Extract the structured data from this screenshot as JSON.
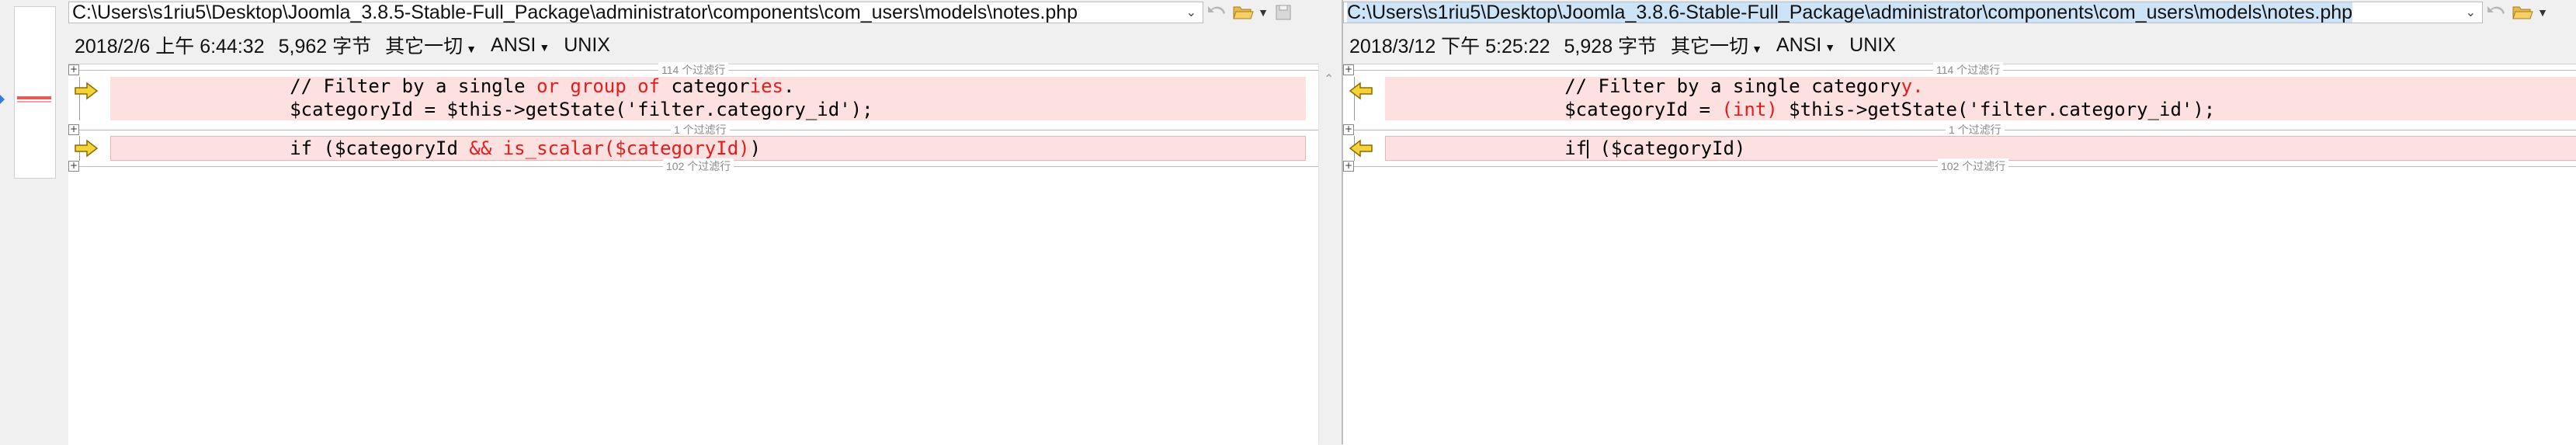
{
  "left": {
    "path": "C:\\Users\\s1riu5\\Desktop\\Joomla_3.8.5-Stable-Full_Package\\administrator\\components\\com_users\\models\\notes.php",
    "info": {
      "datetime": "2018/2/6 上午 6:44:32",
      "size": "5,962 字节",
      "filter": "其它一切",
      "encoding": "ANSI",
      "lineending": "UNIX"
    },
    "sep1": "114 个过滤行",
    "sep2": "1 个过滤行",
    "sep3": "102 个过滤行",
    "line1": {
      "indent": "                ",
      "a": "// Filter by a single ",
      "b": "or group of",
      "c": " categor",
      "d": "ies",
      "e": "."
    },
    "line2": {
      "indent": "                ",
      "text": "$categoryId = $this->getState('filter.category_id');"
    },
    "line3": {
      "indent": "                ",
      "a": "if ($categoryId ",
      "b": "&& is_scalar($categoryId)",
      "c": ")"
    }
  },
  "right": {
    "path": "C:\\Users\\s1riu5\\Desktop\\Joomla_3.8.6-Stable-Full_Package\\administrator\\components\\com_users\\models\\notes.php",
    "info": {
      "datetime": "2018/3/12 下午 5:25:22",
      "size": "5,928 字节",
      "filter": "其它一切",
      "encoding": "ANSI",
      "lineending": "UNIX"
    },
    "sep1": "114 个过滤行",
    "sep2": "1 个过滤行",
    "sep3": "102 个过滤行",
    "line1": {
      "indent": "                ",
      "a": "// Filter by a single category",
      "b": "y",
      "c": "."
    },
    "line2": {
      "indent": "                ",
      "a": "$categoryId = ",
      "b": "(int)",
      "c": " $this->getState('filter.category_id');"
    },
    "line3": {
      "indent": "                ",
      "a": "if",
      "b": " ($categoryId)"
    }
  },
  "icons": {
    "dropdown": "chevron-down-icon",
    "undo": "undo-icon",
    "folder": "folder-open-icon",
    "save": "save-icon",
    "arrow_right": "arrow-right-icon",
    "arrow_left": "arrow-left-icon"
  },
  "colors": {
    "diff_bg": "#fde0e0",
    "changed_text": "#e21d1d",
    "arrow_fill": "#f4d23a"
  }
}
